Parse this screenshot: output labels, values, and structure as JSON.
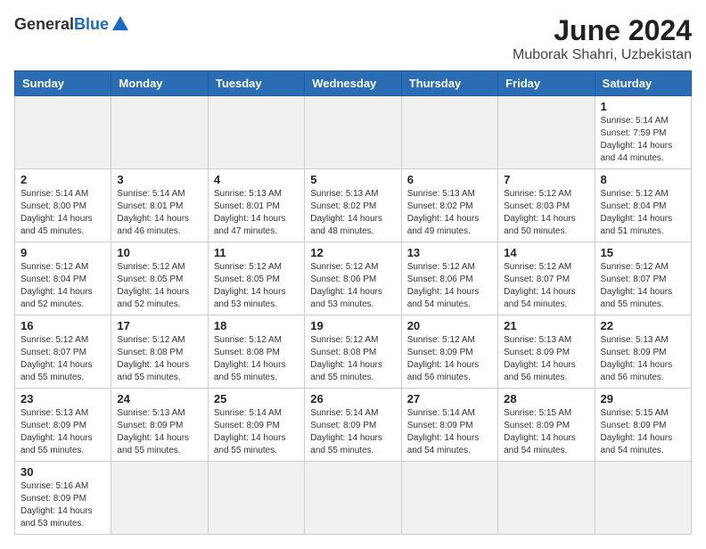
{
  "header": {
    "logo_general": "General",
    "logo_blue": "Blue",
    "month_title": "June 2024",
    "location": "Muborak Shahri, Uzbekistan"
  },
  "weekdays": [
    "Sunday",
    "Monday",
    "Tuesday",
    "Wednesday",
    "Thursday",
    "Friday",
    "Saturday"
  ],
  "weeks": [
    [
      {
        "day": "",
        "info": ""
      },
      {
        "day": "",
        "info": ""
      },
      {
        "day": "",
        "info": ""
      },
      {
        "day": "",
        "info": ""
      },
      {
        "day": "",
        "info": ""
      },
      {
        "day": "",
        "info": ""
      },
      {
        "day": "1",
        "info": "Sunrise: 5:14 AM\nSunset: 7:59 PM\nDaylight: 14 hours and 44 minutes."
      }
    ],
    [
      {
        "day": "2",
        "info": "Sunrise: 5:14 AM\nSunset: 8:00 PM\nDaylight: 14 hours and 45 minutes."
      },
      {
        "day": "3",
        "info": "Sunrise: 5:14 AM\nSunset: 8:01 PM\nDaylight: 14 hours and 46 minutes."
      },
      {
        "day": "4",
        "info": "Sunrise: 5:13 AM\nSunset: 8:01 PM\nDaylight: 14 hours and 47 minutes."
      },
      {
        "day": "5",
        "info": "Sunrise: 5:13 AM\nSunset: 8:02 PM\nDaylight: 14 hours and 48 minutes."
      },
      {
        "day": "6",
        "info": "Sunrise: 5:13 AM\nSunset: 8:02 PM\nDaylight: 14 hours and 49 minutes."
      },
      {
        "day": "7",
        "info": "Sunrise: 5:12 AM\nSunset: 8:03 PM\nDaylight: 14 hours and 50 minutes."
      },
      {
        "day": "8",
        "info": "Sunrise: 5:12 AM\nSunset: 8:04 PM\nDaylight: 14 hours and 51 minutes."
      }
    ],
    [
      {
        "day": "9",
        "info": "Sunrise: 5:12 AM\nSunset: 8:04 PM\nDaylight: 14 hours and 52 minutes."
      },
      {
        "day": "10",
        "info": "Sunrise: 5:12 AM\nSunset: 8:05 PM\nDaylight: 14 hours and 52 minutes."
      },
      {
        "day": "11",
        "info": "Sunrise: 5:12 AM\nSunset: 8:05 PM\nDaylight: 14 hours and 53 minutes."
      },
      {
        "day": "12",
        "info": "Sunrise: 5:12 AM\nSunset: 8:06 PM\nDaylight: 14 hours and 53 minutes."
      },
      {
        "day": "13",
        "info": "Sunrise: 5:12 AM\nSunset: 8:06 PM\nDaylight: 14 hours and 54 minutes."
      },
      {
        "day": "14",
        "info": "Sunrise: 5:12 AM\nSunset: 8:07 PM\nDaylight: 14 hours and 54 minutes."
      },
      {
        "day": "15",
        "info": "Sunrise: 5:12 AM\nSunset: 8:07 PM\nDaylight: 14 hours and 55 minutes."
      }
    ],
    [
      {
        "day": "16",
        "info": "Sunrise: 5:12 AM\nSunset: 8:07 PM\nDaylight: 14 hours and 55 minutes."
      },
      {
        "day": "17",
        "info": "Sunrise: 5:12 AM\nSunset: 8:08 PM\nDaylight: 14 hours and 55 minutes."
      },
      {
        "day": "18",
        "info": "Sunrise: 5:12 AM\nSunset: 8:08 PM\nDaylight: 14 hours and 55 minutes."
      },
      {
        "day": "19",
        "info": "Sunrise: 5:12 AM\nSunset: 8:08 PM\nDaylight: 14 hours and 55 minutes."
      },
      {
        "day": "20",
        "info": "Sunrise: 5:12 AM\nSunset: 8:09 PM\nDaylight: 14 hours and 56 minutes."
      },
      {
        "day": "21",
        "info": "Sunrise: 5:13 AM\nSunset: 8:09 PM\nDaylight: 14 hours and 56 minutes."
      },
      {
        "day": "22",
        "info": "Sunrise: 5:13 AM\nSunset: 8:09 PM\nDaylight: 14 hours and 56 minutes."
      }
    ],
    [
      {
        "day": "23",
        "info": "Sunrise: 5:13 AM\nSunset: 8:09 PM\nDaylight: 14 hours and 55 minutes."
      },
      {
        "day": "24",
        "info": "Sunrise: 5:13 AM\nSunset: 8:09 PM\nDaylight: 14 hours and 55 minutes."
      },
      {
        "day": "25",
        "info": "Sunrise: 5:14 AM\nSunset: 8:09 PM\nDaylight: 14 hours and 55 minutes."
      },
      {
        "day": "26",
        "info": "Sunrise: 5:14 AM\nSunset: 8:09 PM\nDaylight: 14 hours and 55 minutes."
      },
      {
        "day": "27",
        "info": "Sunrise: 5:14 AM\nSunset: 8:09 PM\nDaylight: 14 hours and 54 minutes."
      },
      {
        "day": "28",
        "info": "Sunrise: 5:15 AM\nSunset: 8:09 PM\nDaylight: 14 hours and 54 minutes."
      },
      {
        "day": "29",
        "info": "Sunrise: 5:15 AM\nSunset: 8:09 PM\nDaylight: 14 hours and 54 minutes."
      }
    ],
    [
      {
        "day": "30",
        "info": "Sunrise: 5:16 AM\nSunset: 8:09 PM\nDaylight: 14 hours and 53 minutes."
      },
      {
        "day": "",
        "info": ""
      },
      {
        "day": "",
        "info": ""
      },
      {
        "day": "",
        "info": ""
      },
      {
        "day": "",
        "info": ""
      },
      {
        "day": "",
        "info": ""
      },
      {
        "day": "",
        "info": ""
      }
    ]
  ]
}
